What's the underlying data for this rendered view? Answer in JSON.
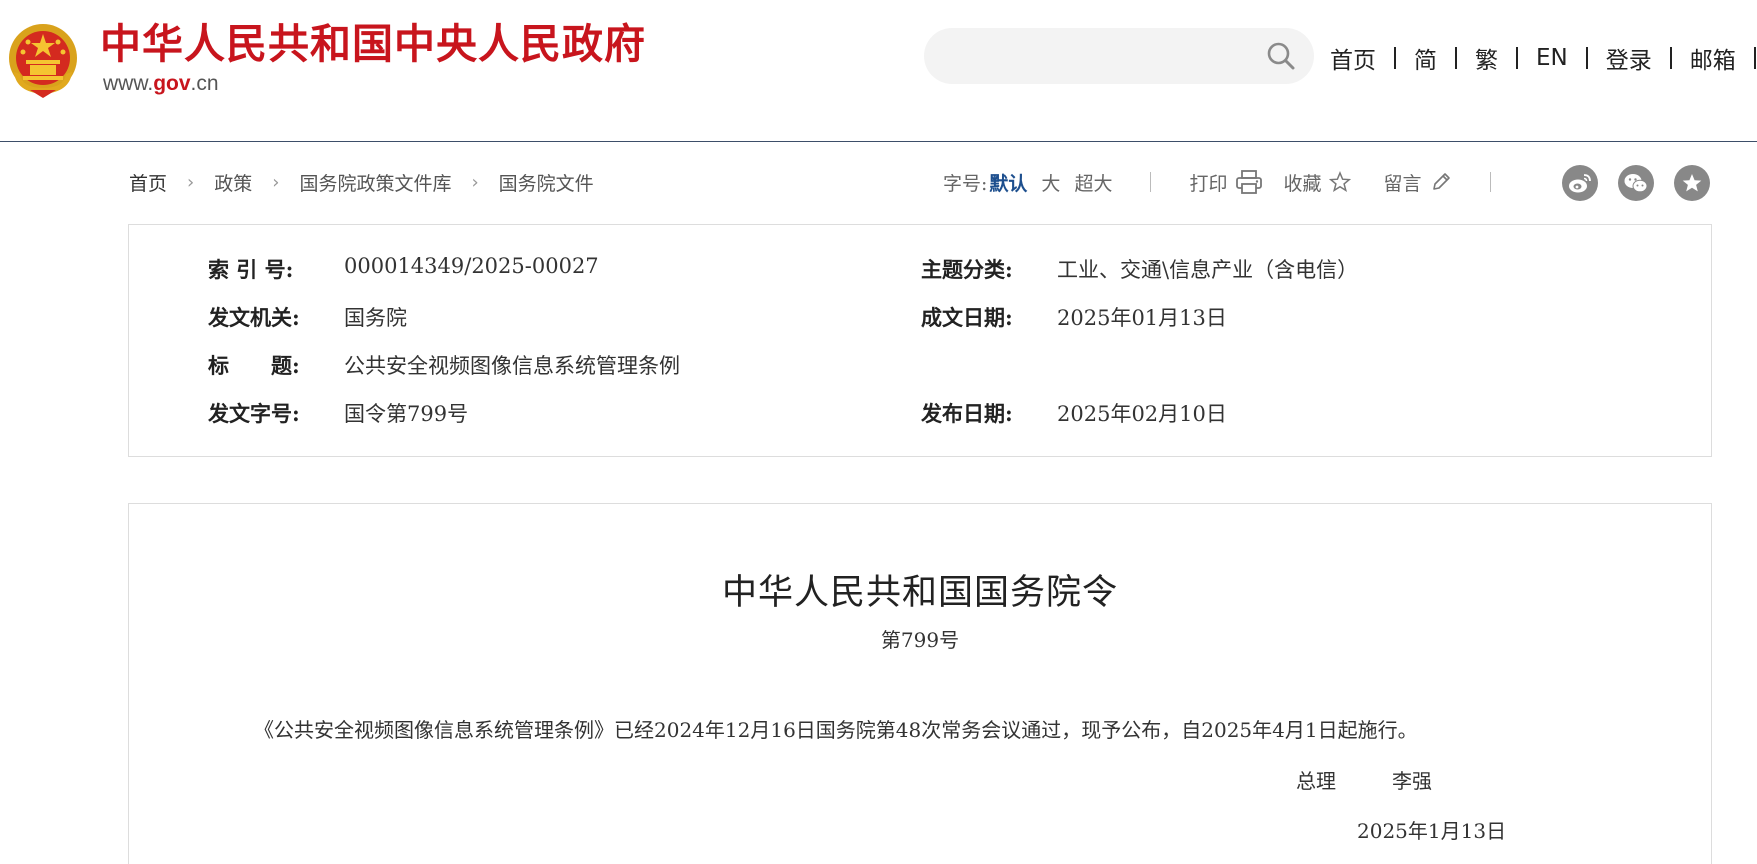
{
  "header": {
    "site_title": "中华人民共和国中央人民政府",
    "url_prefix": "www.",
    "url_main": "gov",
    "url_suffix": ".cn",
    "search_placeholder": "",
    "nav": [
      "首页",
      "简",
      "繁",
      "EN",
      "登录",
      "邮箱"
    ]
  },
  "breadcrumb": [
    "首页",
    "政策",
    "国务院政策文件库",
    "国务院文件"
  ],
  "toolbar": {
    "font_size_label": "字号:",
    "font_default": "默认",
    "font_large": "大",
    "font_xlarge": "超大",
    "print": "打印",
    "favorite": "收藏",
    "comment": "留言",
    "share_icons": [
      "weibo-icon",
      "wechat-icon",
      "favorite-star-icon"
    ]
  },
  "meta": {
    "index_label": "索 引 号:",
    "index_value": "000014349/2025-00027",
    "topic_label": "主题分类:",
    "topic_value": "工业、交通\\信息产业（含电信）",
    "issuer_label": "发文机关:",
    "issuer_value": "国务院",
    "written_date_label": "成文日期:",
    "written_date_value": "2025年01月13日",
    "title_label": "标　　题:",
    "title_value": "公共安全视频图像信息系统管理条例",
    "doc_no_label": "发文字号:",
    "doc_no_value": "国令第799号",
    "publish_date_label": "发布日期:",
    "publish_date_value": "2025年02月10日"
  },
  "document": {
    "title": "中华人民共和国国务院令",
    "number": "第799号",
    "body": "《公共安全视频图像信息系统管理条例》已经2024年12月16日国务院第48次常务会议通过，现予公布，自2025年4月1日起施行。",
    "premier_title": "总理",
    "premier_name": "李强",
    "date": "2025年1月13日"
  },
  "colors": {
    "brand_red": "#c8151d",
    "active_blue": "#1d4f8e",
    "header_rule": "#3d4e69"
  }
}
